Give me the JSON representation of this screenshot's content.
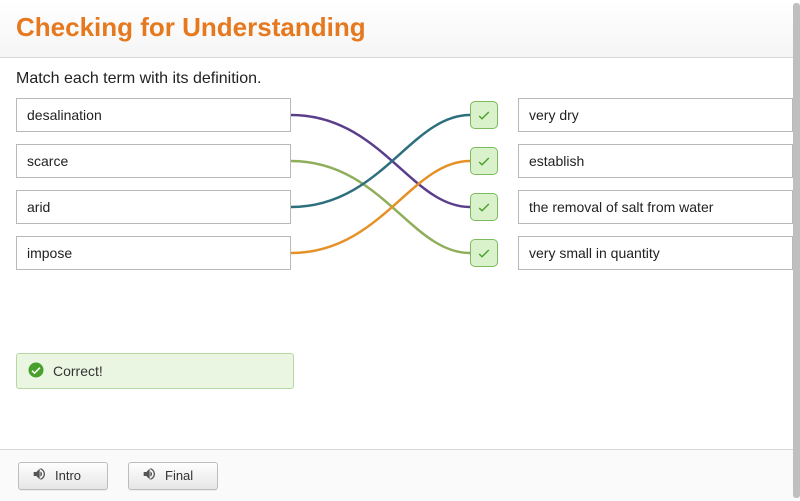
{
  "header": {
    "title": "Checking for Understanding"
  },
  "instruction": "Match each term with its definition.",
  "terms": [
    {
      "label": "desalination"
    },
    {
      "label": "scarce"
    },
    {
      "label": "arid"
    },
    {
      "label": "impose"
    }
  ],
  "definitions": [
    {
      "label": "very dry"
    },
    {
      "label": "establish"
    },
    {
      "label": "the removal of salt from water"
    },
    {
      "label": "very small in quantity"
    }
  ],
  "connections": [
    {
      "from": 0,
      "to": 2,
      "color": "#5a3e8c"
    },
    {
      "from": 1,
      "to": 3,
      "color": "#8fae5a"
    },
    {
      "from": 2,
      "to": 0,
      "color": "#2e6f7e"
    },
    {
      "from": 3,
      "to": 1,
      "color": "#e69127"
    }
  ],
  "checks_color": "#4aa02c",
  "feedback": {
    "label": "Correct!"
  },
  "footer": {
    "intro_label": "Intro",
    "final_label": "Final"
  }
}
